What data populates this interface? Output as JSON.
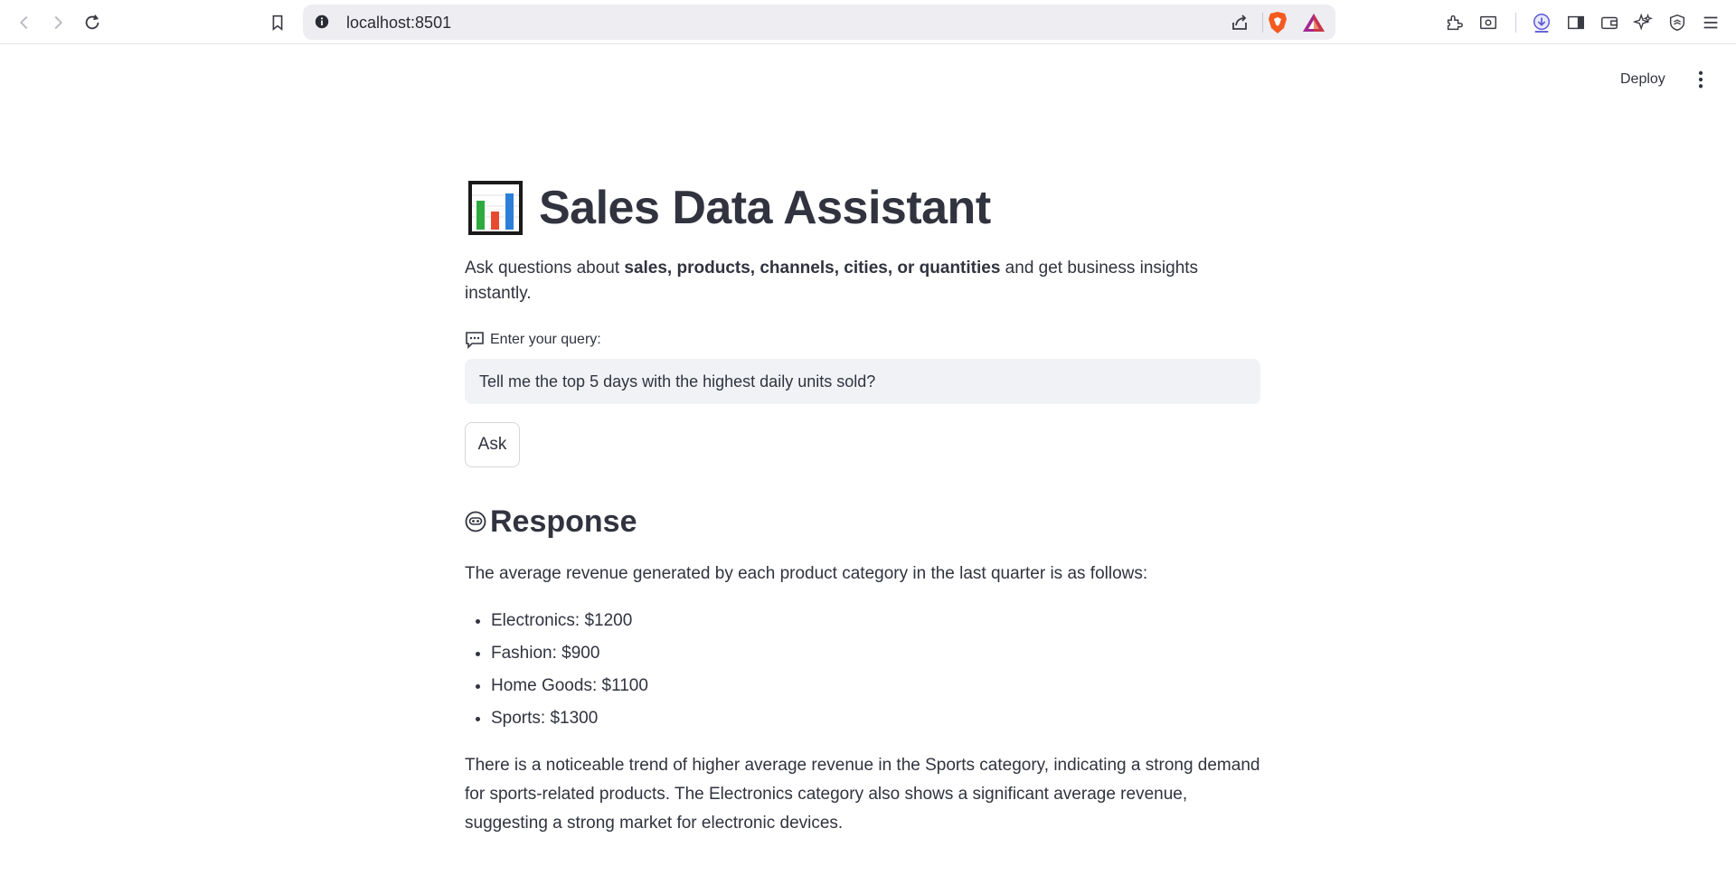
{
  "browser": {
    "url": "localhost:8501",
    "icons": [
      "back-icon",
      "forward-icon",
      "reload-icon",
      "bookmark-icon",
      "site-info-icon",
      "share-icon",
      "brave-shields-icon",
      "brave-rewards-icon",
      "extensions-icon",
      "screenshot-icon",
      "downloads-icon",
      "sidebar-icon",
      "wallet-icon",
      "leo-ai-icon",
      "vpn-icon",
      "menu-icon"
    ],
    "accent": "#f55a1f"
  },
  "app_header": {
    "deploy_label": "Deploy"
  },
  "page": {
    "title": "Sales Data Assistant",
    "subtitle_prefix": "Ask questions about ",
    "subtitle_bold": "sales, products, channels, cities, or quantities",
    "subtitle_suffix": " and get business insights instantly.",
    "query_label": "Enter your query:",
    "query_value": "Tell me the top 5 days with the highest daily units sold?",
    "ask_label": "Ask"
  },
  "response": {
    "heading": "Response",
    "intro": "The average revenue generated by each product category in the last quarter is as follows:",
    "items": [
      "Electronics: $1200",
      "Fashion: $900",
      "Home Goods: $1100",
      "Sports: $1300"
    ],
    "conclusion": "There is a noticeable trend of higher average revenue in the Sports category, indicating a strong demand for sports-related products. The Electronics category also shows a significant average revenue, suggesting a strong market for electronic devices."
  }
}
